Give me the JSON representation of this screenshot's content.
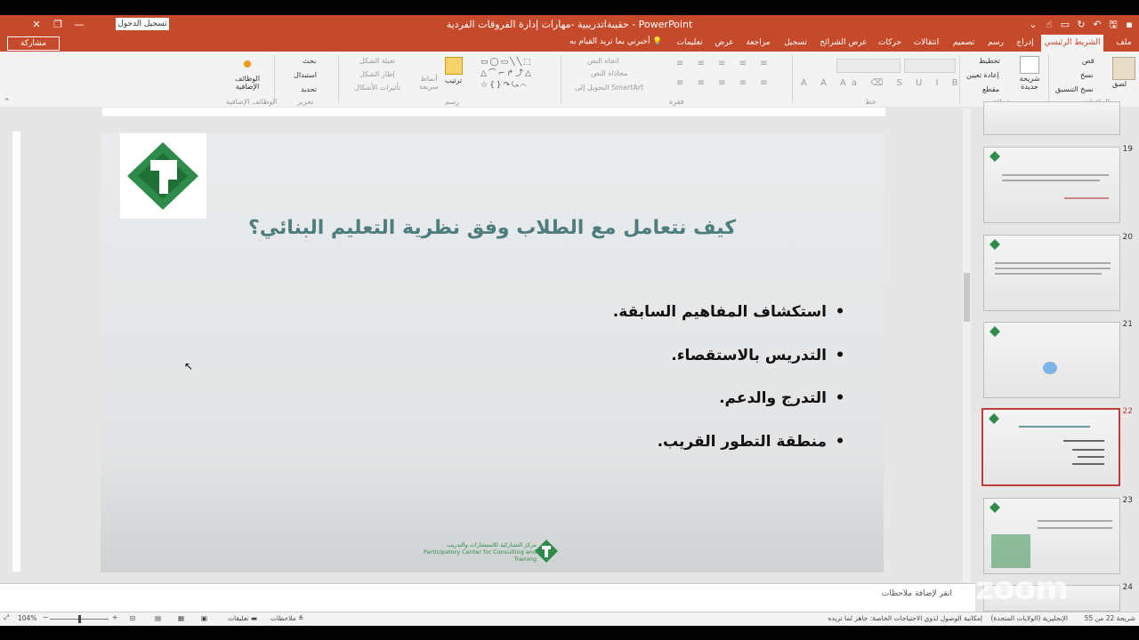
{
  "window": {
    "title": "حقيبةاتدريبية -مهارات إدارة الفروقات الفردية  -  PowerPoint",
    "login_button": "تسجيل الدخول"
  },
  "tabs": [
    "ملف",
    "الشريط الرئيسي",
    "إدراج",
    "رسم",
    "تصميم",
    "انتقالات",
    "حركات",
    "عرض الشرائح",
    "تسجيل",
    "مراجعة",
    "عرض",
    "تعليمات"
  ],
  "tell_me": "أخبرني بما تريد القيام به",
  "share_button": "مشاركة",
  "ribbon": {
    "clipboard": {
      "paste": "لصق",
      "cut": "قص",
      "copy": "نسخ",
      "format_painter": "نسخ التنسيق",
      "group": "الحافظة"
    },
    "slides": {
      "new_slide": "شريحة جديدة",
      "layout": "تخطيط",
      "reset": "إعادة تعيين",
      "section": "مقطع",
      "group": "شرائح"
    },
    "font_group": "خط",
    "paragraph": {
      "text_direction": "اتجاه النص",
      "align_text": "محاذاة النص",
      "smartart": "التحويل إلى SmartArt",
      "group": "فقرة"
    },
    "drawing": {
      "arrange": "ترتيب",
      "quick_styles": "أنماط سريعة",
      "shape_fill": "تعبئة الشكل",
      "shape_outline": "إطار الشكل",
      "shape_effects": "تأثيرات الأشكال",
      "group": "رسم"
    },
    "editing": {
      "find": "بحث",
      "replace": "استبدال",
      "select": "تحديد",
      "group": "تحرير"
    },
    "addins": {
      "label": "الوظائف الإضافية",
      "group": "الوظائف الإضافية"
    }
  },
  "slide": {
    "title": "كيف نتعامل مع الطلاب وفق نظرية التعليم البنائي؟",
    "bullets": [
      "استكشاف المفاهيم السابقة.",
      "التدريس بالاستقصاء.",
      "التدرج والدعم.",
      "منطقة التطور القريب."
    ],
    "footer_logo_ar": "مركز التشاركية للاستشارات والتدريب",
    "footer_logo_en": "Participatory Center for Consulting and Training"
  },
  "notes_placeholder": "انقر لإضافة ملاحظات",
  "thumbnails": [
    {
      "num": "19",
      "selected": false
    },
    {
      "num": "20",
      "selected": false
    },
    {
      "num": "21",
      "selected": false
    },
    {
      "num": "22",
      "selected": true
    },
    {
      "num": "23",
      "selected": false
    },
    {
      "num": "24",
      "selected": false
    }
  ],
  "status": {
    "slide_pos": "شريحة 22 من 55",
    "language": "الإنجليزية (الولايات المتحدة)",
    "accessibility": "إمكانية الوصول لذوي الاحتياجات الخاصة: جاهز لما تريده",
    "notes": "ملاحظات",
    "comments": "تعليقات",
    "zoom": "104%"
  },
  "watermark": "zoom",
  "colors": {
    "accent": "#c5492b",
    "title": "#4e7d7f",
    "logo_green": "#2f8b4a",
    "selected_thumb": "#c13b3b"
  }
}
